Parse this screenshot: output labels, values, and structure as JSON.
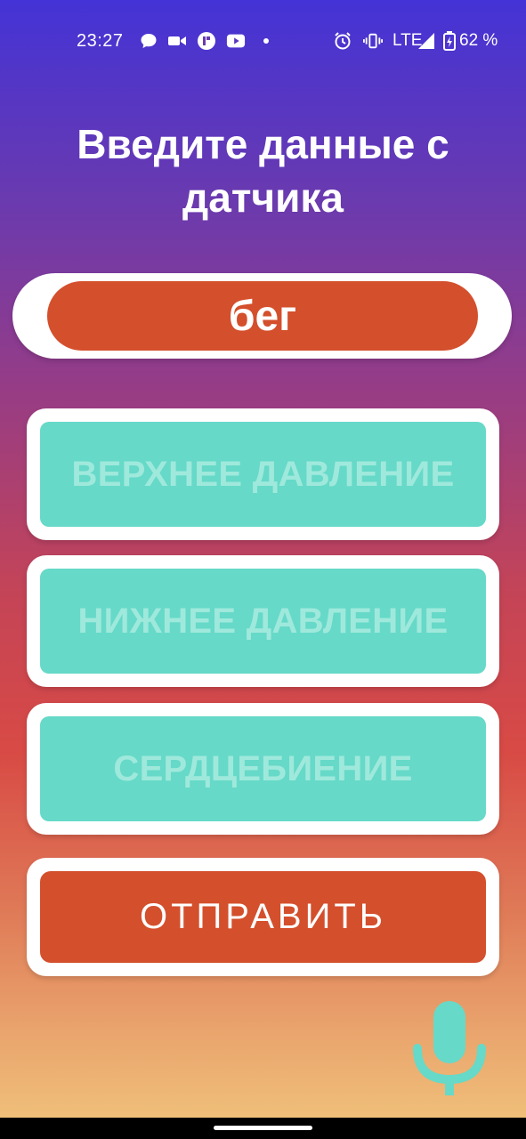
{
  "status_bar": {
    "time": "23:27",
    "network": "LTE",
    "battery": "62 %",
    "icons": [
      "message-icon",
      "video-icon",
      "app-icon",
      "youtube-icon",
      "dot-icon",
      "alarm-icon",
      "vibrate-icon",
      "signal-icon",
      "battery-icon"
    ]
  },
  "title": "Введите данные с датчика",
  "activity": {
    "label": "бег"
  },
  "fields": {
    "upper_pressure": "ВЕРХНЕЕ ДАВЛЕНИЕ",
    "lower_pressure": "НИЖНЕЕ ДАВЛЕНИЕ",
    "heartbeat": "СЕРДЦЕБИЕНИЕ"
  },
  "send_button": "ОТПРАВИТЬ",
  "mic": {
    "icon": "microphone-icon"
  },
  "colors": {
    "accent": "#d44f2c",
    "field": "#66d9c8",
    "field_hint": "#9fe9dc",
    "mic": "#66d9c8"
  }
}
